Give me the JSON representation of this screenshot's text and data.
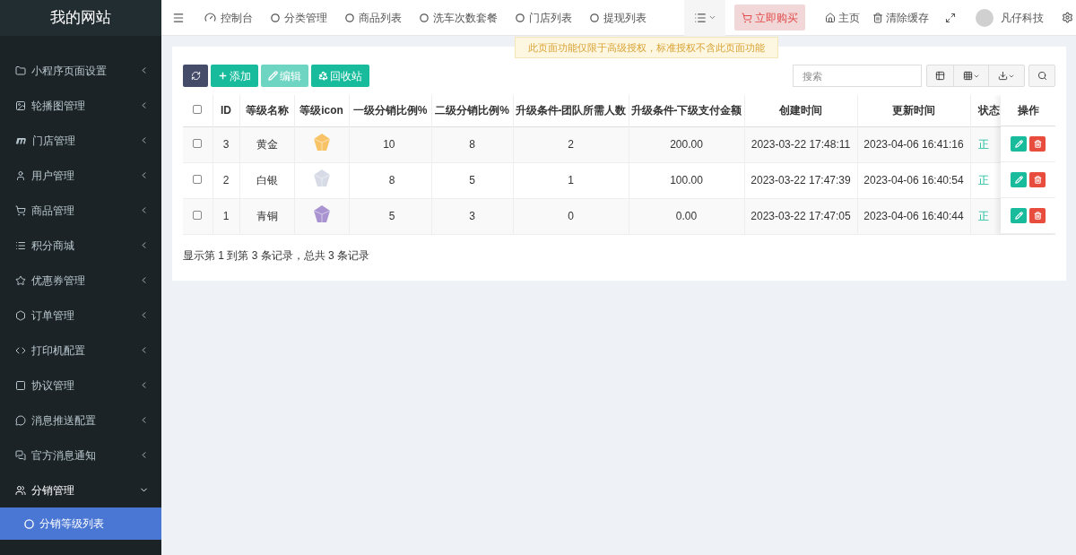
{
  "sidebar": {
    "title": "我的网站",
    "items": [
      {
        "label": "小程序页面设置",
        "expanded": false
      },
      {
        "label": "轮播图管理",
        "expanded": false
      },
      {
        "label": "门店管理",
        "expanded": false
      },
      {
        "label": "用户管理",
        "expanded": false
      },
      {
        "label": "商品管理",
        "expanded": false
      },
      {
        "label": "积分商城",
        "expanded": false
      },
      {
        "label": "优惠券管理",
        "expanded": false
      },
      {
        "label": "订单管理",
        "expanded": false
      },
      {
        "label": "打印机配置",
        "expanded": false
      },
      {
        "label": "协议管理",
        "expanded": false
      },
      {
        "label": "消息推送配置",
        "expanded": false
      },
      {
        "label": "官方消息通知",
        "expanded": false
      },
      {
        "label": "分销管理",
        "expanded": true,
        "children": [
          {
            "label": "分销等级列表",
            "selected": true
          }
        ]
      }
    ]
  },
  "nav_tabs": [
    {
      "label": "控制台",
      "selected": false
    },
    {
      "label": "分类管理",
      "selected": false
    },
    {
      "label": "商品列表",
      "selected": false
    },
    {
      "label": "洗车次数套餐",
      "selected": false
    },
    {
      "label": "门店列表",
      "selected": false
    },
    {
      "label": "提现列表",
      "selected": false
    }
  ],
  "header_actions": {
    "buy": "立即购买",
    "home": "主页",
    "clear_cache": "清除缓存",
    "user": "凡仔科技"
  },
  "notice": "此页面功能仅限于高级授权，标准授权不含此页面功能",
  "toolbar": {
    "buttons": [
      {
        "label": "添加",
        "disabled": false
      },
      {
        "label": "编辑",
        "disabled": true
      },
      {
        "label": "回收站",
        "disabled": false
      }
    ],
    "search": {
      "placeholder": "搜索"
    }
  },
  "table": {
    "all_checked": false,
    "columns": [
      "ID",
      "等级名称",
      "等级icon",
      "一级分销比例%",
      "二级分销比例%",
      "升级条件-团队所需人数",
      "升级条件-下级支付金额",
      "创建时间",
      "更新时间",
      "状态"
    ],
    "action_column": "操作",
    "rows": [
      {
        "checked": false,
        "id": "3",
        "name": "黄金",
        "level1": "10",
        "level2": "8",
        "team": "2",
        "amount": "200.00",
        "created": "2023-03-22 17:48:11",
        "updated": "2023-04-06 16:41:16",
        "status": "正"
      },
      {
        "checked": false,
        "id": "2",
        "name": "白银",
        "level1": "8",
        "level2": "5",
        "team": "1",
        "amount": "100.00",
        "created": "2023-03-22 17:47:39",
        "updated": "2023-04-06 16:40:54",
        "status": "正"
      },
      {
        "checked": false,
        "id": "1",
        "name": "青铜",
        "level1": "5",
        "level2": "3",
        "team": "0",
        "amount": "0.00",
        "created": "2023-03-22 17:47:05",
        "updated": "2023-04-06 16:40:44",
        "status": "正"
      }
    ],
    "footer": "显示第 1 到第 3 条记录，总共 3 条记录"
  }
}
